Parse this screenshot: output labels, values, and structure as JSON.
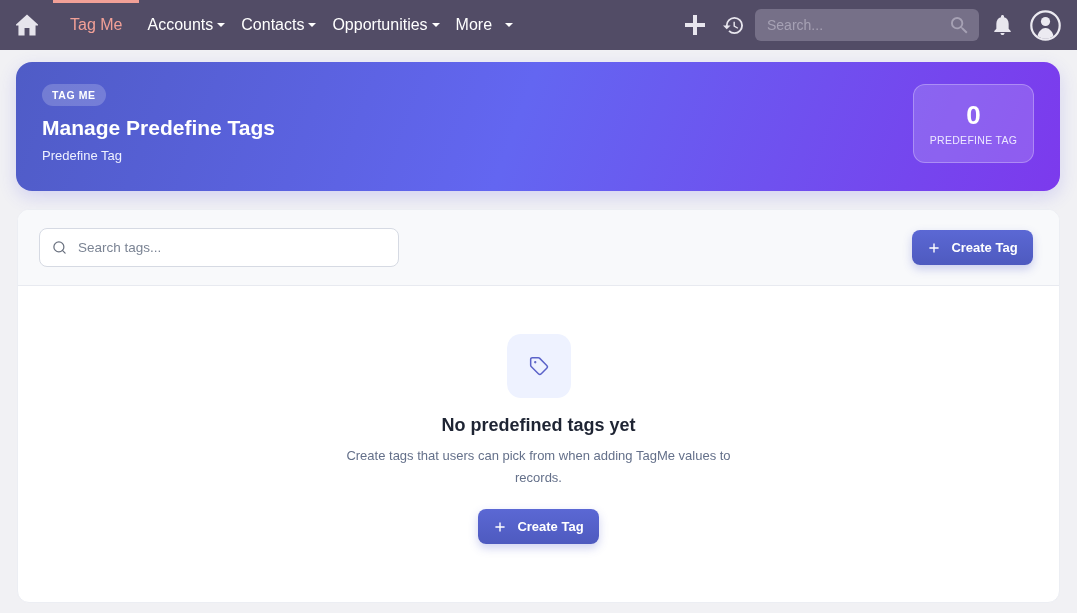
{
  "navbar": {
    "tabs": [
      {
        "label": "Tag Me",
        "selected": true,
        "dropdown": false
      },
      {
        "label": "Accounts",
        "selected": false,
        "dropdown": true
      },
      {
        "label": "Contacts",
        "selected": false,
        "dropdown": true
      },
      {
        "label": "Opportunities",
        "selected": false,
        "dropdown": true
      },
      {
        "label": "More",
        "selected": false,
        "dropdown": true
      }
    ],
    "search": {
      "placeholder": "Search..."
    }
  },
  "header": {
    "badge": "TAG ME",
    "title": "Manage Predefine Tags",
    "subtitle": "Predefine Tag",
    "stat": {
      "value": "0",
      "label": "PREDEFINE TAG"
    }
  },
  "toolbar": {
    "search": {
      "placeholder": "Search tags..."
    },
    "create_button": "Create Tag"
  },
  "empty_state": {
    "title": "No predefined tags yet",
    "description": "Create tags that users can pick from when adding TagMe values to records.",
    "button": "Create Tag"
  }
}
